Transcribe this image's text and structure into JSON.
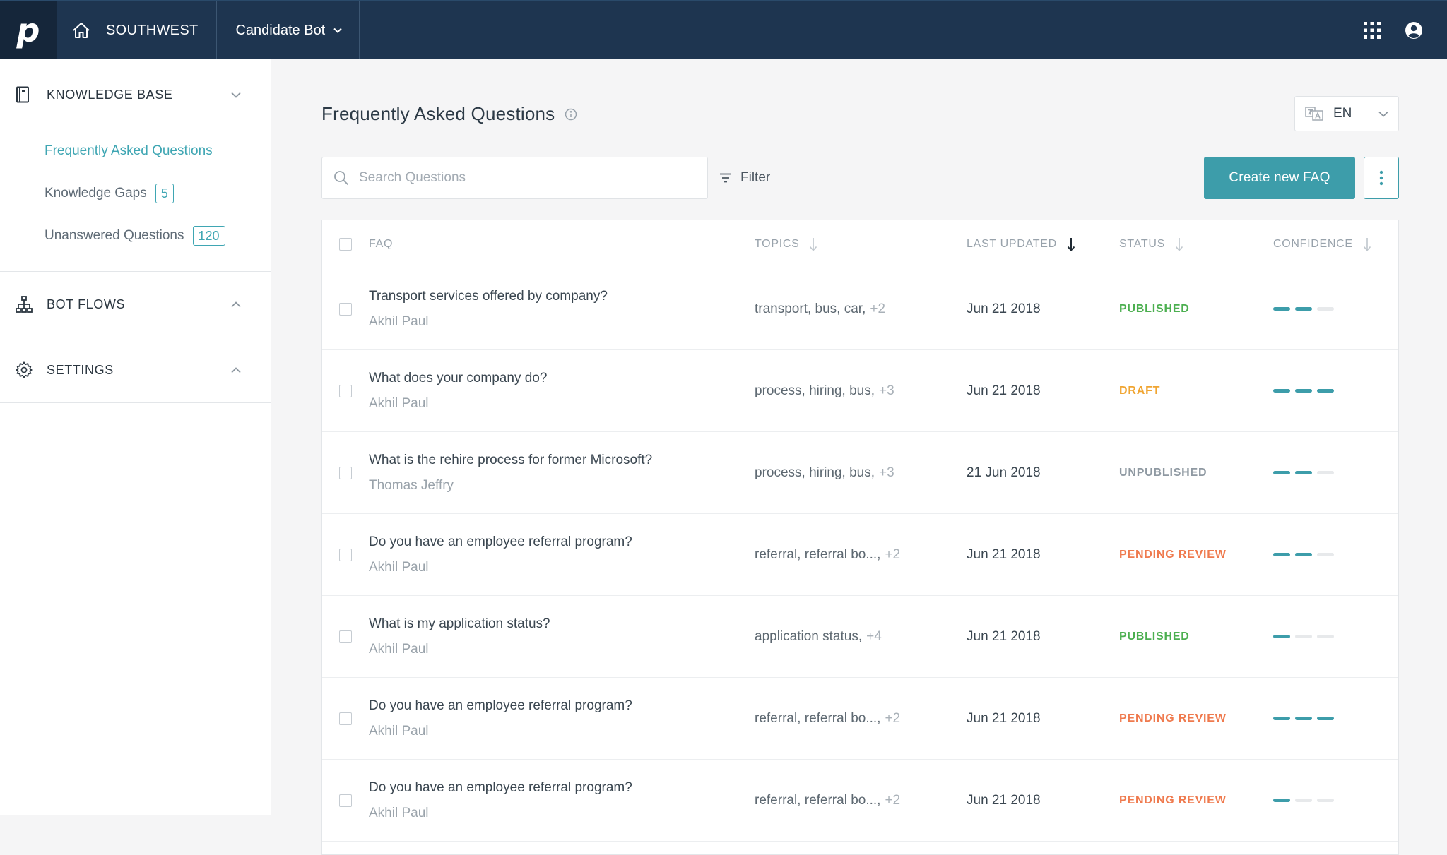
{
  "topbar": {
    "logo": "p",
    "org_name": "SOUTHWEST",
    "bot_name": "Candidate Bot"
  },
  "sidebar": {
    "knowledge_base": {
      "label": "KNOWLEDGE BASE",
      "items": [
        {
          "label": "Frequently Asked Questions",
          "active": true
        },
        {
          "label": "Knowledge Gaps",
          "badge": "5"
        },
        {
          "label": "Unanswered Questions",
          "badge": "120"
        }
      ]
    },
    "bot_flows": {
      "label": "BOT FLOWS"
    },
    "settings": {
      "label": "SETTINGS"
    }
  },
  "main": {
    "title": "Frequently Asked Questions",
    "language": "EN",
    "search_placeholder": "Search Questions",
    "filter_label": "Filter",
    "create_label": "Create new FAQ"
  },
  "table": {
    "headers": {
      "faq": "FAQ",
      "topics": "TOPICS",
      "updated": "LAST UPDATED",
      "status": "STATUS",
      "confidence": "CONFIDENCE"
    },
    "rows": [
      {
        "question": "Transport services offered by company?",
        "author": "Akhil Paul",
        "topics": "transport, bus, car,",
        "topics_more": "+2",
        "updated": "Jun 21 2018",
        "status": "PUBLISHED",
        "status_color": "#4caf50",
        "confidence": 2
      },
      {
        "question": "What does your company do?",
        "author": "Akhil Paul",
        "topics": "process, hiring, bus,",
        "topics_more": "+3",
        "updated": "Jun 21 2018",
        "status": "DRAFT",
        "status_color": "#f0a532",
        "confidence": 3
      },
      {
        "question": "What is the rehire process for former Microsoft?",
        "author": "Thomas Jeffry",
        "topics": "process, hiring, bus,",
        "topics_more": "+3",
        "updated": "21 Jun 2018",
        "status": "UNPUBLISHED",
        "status_color": "#8f99a2",
        "confidence": 2
      },
      {
        "question": "Do you have an employee referral program?",
        "author": "Akhil Paul",
        "topics": "referral, referral bo...,",
        "topics_more": "+2",
        "updated": "Jun 21 2018",
        "status": "PENDING REVIEW",
        "status_color": "#ef7a4e",
        "confidence": 2
      },
      {
        "question": "What is my application status?",
        "author": "Akhil Paul",
        "topics": "application status,",
        "topics_more": "+4",
        "updated": "Jun 21 2018",
        "status": "PUBLISHED",
        "status_color": "#4caf50",
        "confidence": 1
      },
      {
        "question": "Do you have an employee referral program?",
        "author": "Akhil Paul",
        "topics": "referral, referral bo...,",
        "topics_more": "+2",
        "updated": "Jun 21 2018",
        "status": "PENDING REVIEW",
        "status_color": "#ef7a4e",
        "confidence": 3
      },
      {
        "question": "Do you have an employee referral program?",
        "author": "Akhil Paul",
        "topics": "referral, referral bo...,",
        "topics_more": "+2",
        "updated": "Jun 21 2018",
        "status": "PENDING REVIEW",
        "status_color": "#ef7a4e",
        "confidence": 1
      }
    ]
  },
  "colors": {
    "topbar": "#1e3550",
    "accent": "#3d9daa"
  }
}
